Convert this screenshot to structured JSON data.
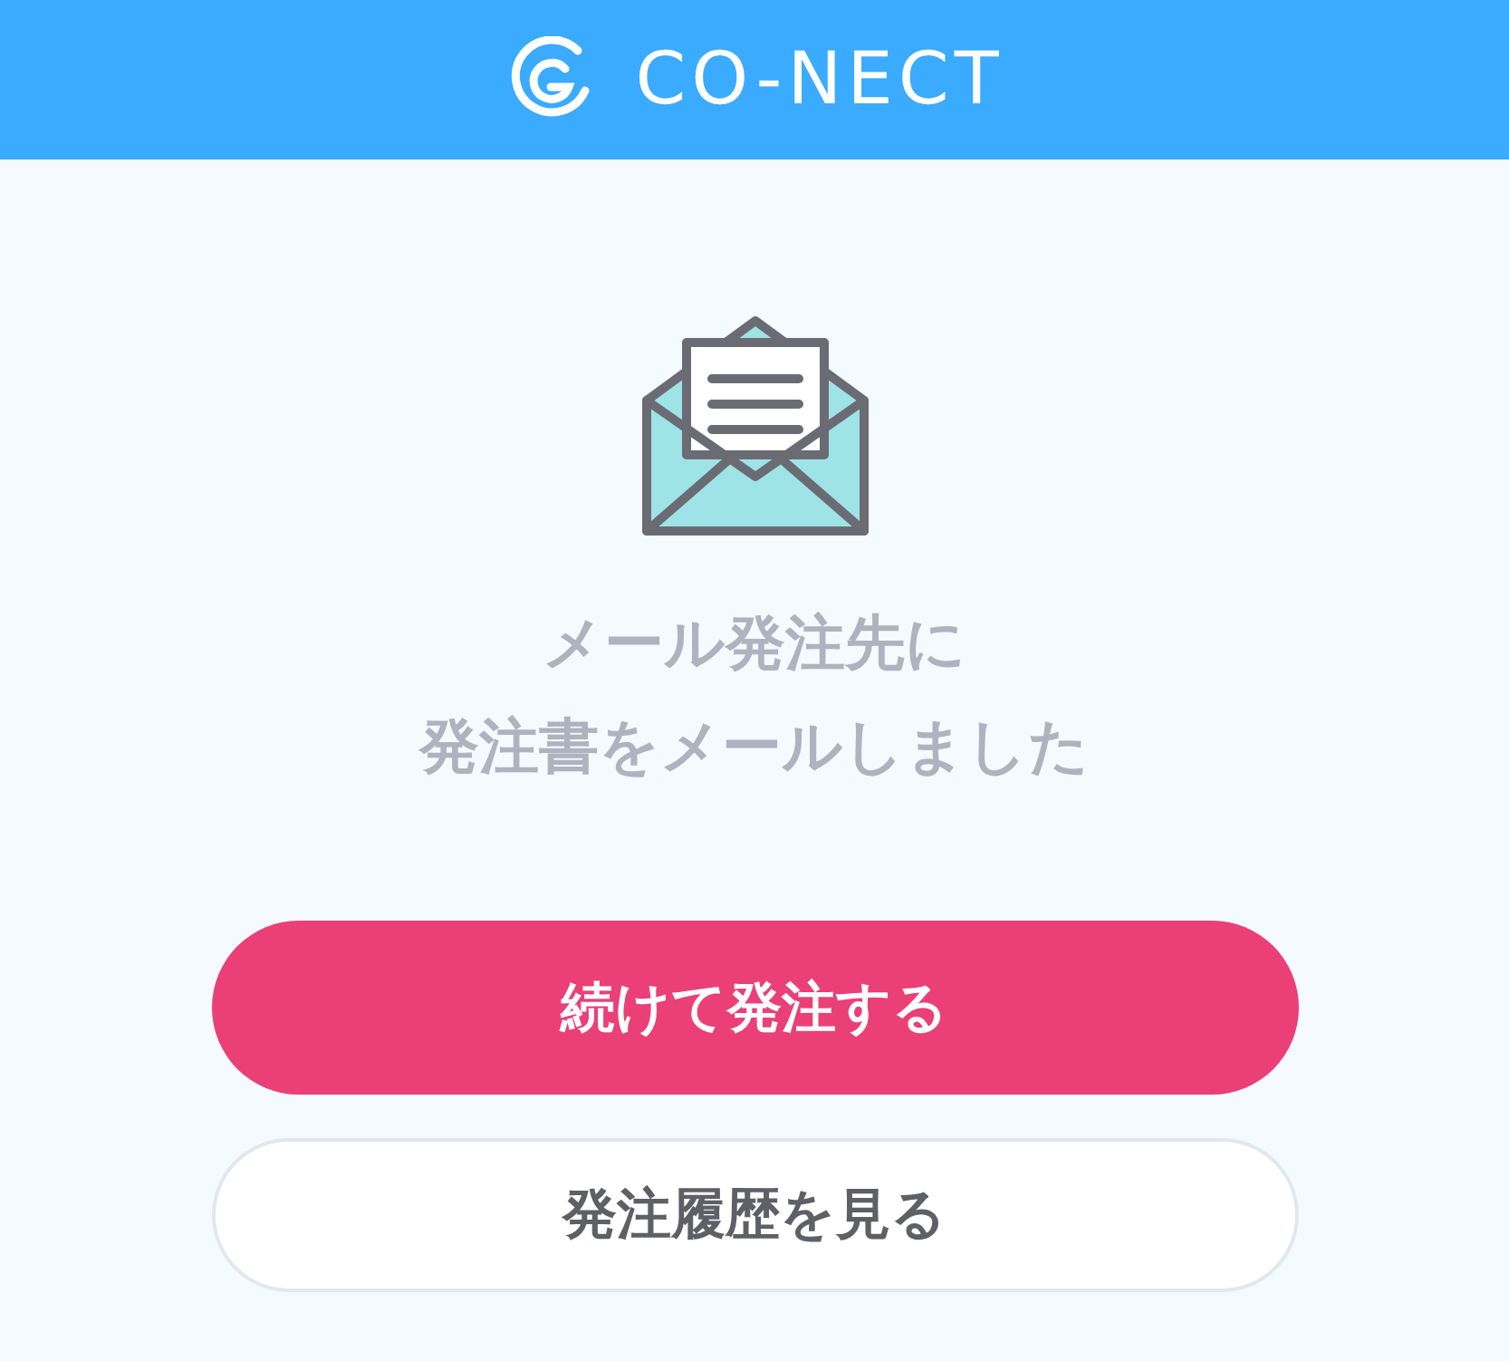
{
  "header": {
    "logo_text": "CO-NECT"
  },
  "message": [
    "メール発注先に",
    "発注書をメールしました"
  ],
  "buttons": [
    {
      "label": "続けて発注する",
      "kind": "primary"
    },
    {
      "label": "発注履歴を見る",
      "kind": "secondary"
    }
  ]
}
